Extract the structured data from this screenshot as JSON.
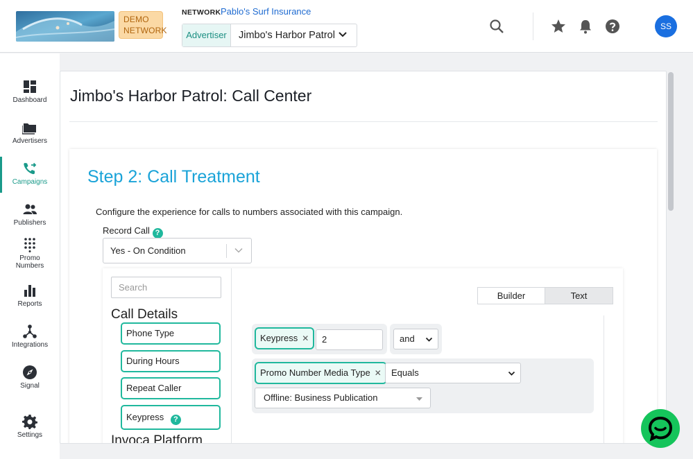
{
  "header": {
    "demo_badge": [
      "DEMO",
      "NETWORK"
    ],
    "network_label": "NETWORK",
    "network_name": "Pablo's Surf Insurance",
    "advertiser_tag": "Advertiser",
    "advertiser_value": "Jimbo's Harbor Patrol",
    "avatar_initials": "SS"
  },
  "sidebar": {
    "items": [
      {
        "label": "Dashboard"
      },
      {
        "label": "Advertisers"
      },
      {
        "label": "Campaigns",
        "active": true
      },
      {
        "label": "Publishers"
      },
      {
        "label": "Promo Numbers"
      },
      {
        "label": "Reports"
      },
      {
        "label": "Integrations"
      },
      {
        "label": "Signal"
      },
      {
        "label": "Settings"
      }
    ]
  },
  "main": {
    "page_title": "Jimbo's Harbor Patrol: Call Center",
    "step_title": "Step 2: Call Treatment",
    "description": "Configure the experience for calls to numbers associated with this campaign.",
    "record_call_label": "Record Call",
    "record_call_value": "Yes - On Condition",
    "builder": {
      "search_placeholder": "Search",
      "section_call_details": "Call Details",
      "fields": [
        "Phone Type",
        "During Hours",
        "Repeat Caller",
        "Keypress"
      ],
      "section_invoca": "Invoca Platform",
      "mode_builder": "Builder",
      "mode_text": "Text",
      "rule1_field": "Keypress",
      "rule1_value": "2",
      "connector": "and",
      "rule2_field": "Promo Number Media Type",
      "rule2_operator": "Equals",
      "rule2_value": "Offline: Business Publication"
    }
  },
  "colors": {
    "accent_teal": "#20b89d",
    "title_blue": "#1aa3d8",
    "link_blue": "#1f6bd1",
    "chat_green": "#15c45b"
  }
}
